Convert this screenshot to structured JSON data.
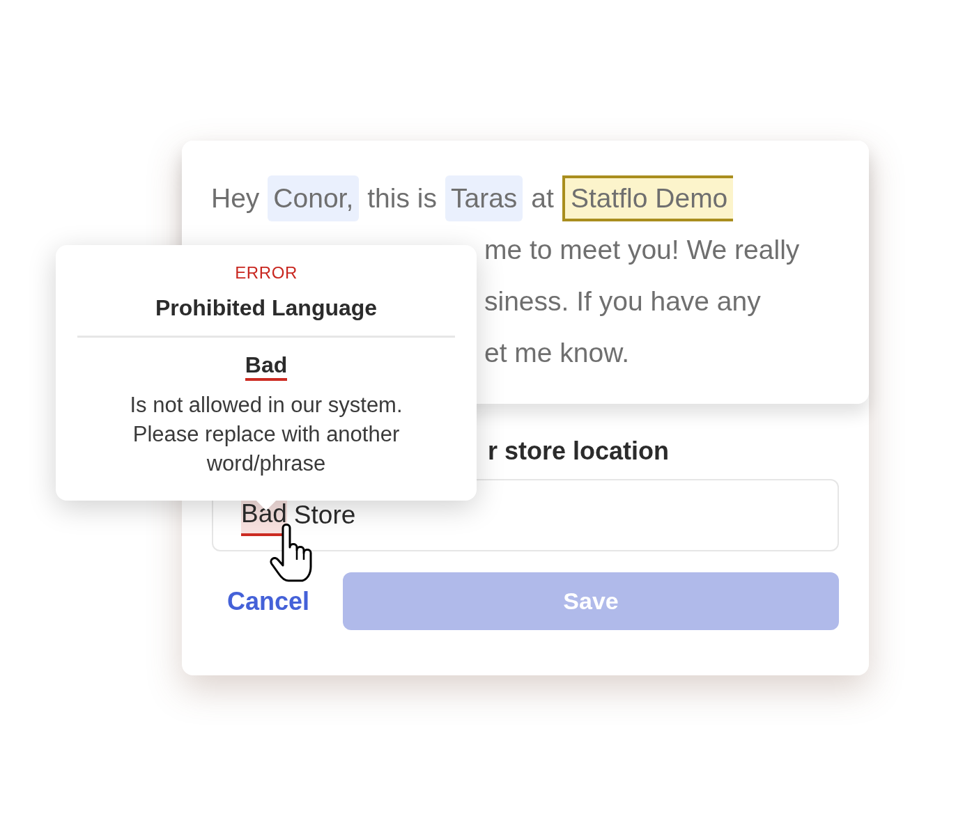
{
  "message": {
    "lines": [
      {
        "segments": [
          {
            "kind": "text",
            "text": "Hey"
          },
          {
            "kind": "variable",
            "text": "Conor,"
          },
          {
            "kind": "text",
            "text": "this is"
          },
          {
            "kind": "variable",
            "text": "Taras"
          },
          {
            "kind": "text",
            "text": "at"
          },
          {
            "kind": "flagged",
            "text": "Statflo Demo"
          }
        ]
      },
      {
        "segments": [
          {
            "kind": "clipped",
            "text": "me to meet you! We really"
          }
        ]
      },
      {
        "segments": [
          {
            "kind": "clipped",
            "text": "siness. If you have any"
          }
        ]
      },
      {
        "segments": [
          {
            "kind": "clipped",
            "text": "et me know."
          }
        ]
      }
    ]
  },
  "popover": {
    "severity": "ERROR",
    "title": "Prohibited Language",
    "word": "Bad",
    "description": "Is not allowed in our system. Please replace with another word/phrase"
  },
  "form": {
    "label": "r store location",
    "input": {
      "parts": [
        {
          "text": "Bad",
          "flagged": true
        },
        {
          "text": "Store",
          "flagged": false
        }
      ]
    },
    "cancel": "Cancel",
    "save": {
      "label": "Save",
      "disabled": true
    }
  }
}
